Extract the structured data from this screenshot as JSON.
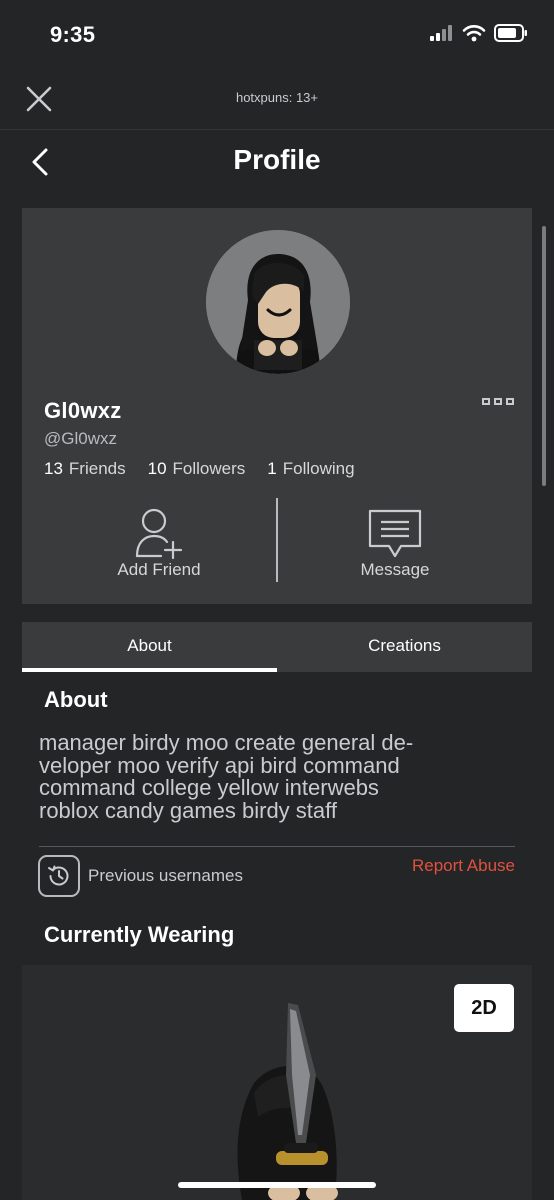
{
  "status_bar": {
    "time": "9:35"
  },
  "topbar": {
    "title": "hotxpuns: 13+",
    "close_icon": "close-icon"
  },
  "nav": {
    "page_title": "Profile",
    "back_icon": "chevron-left-icon"
  },
  "profile": {
    "display_name": "Gl0wxz",
    "username": "@Gl0wxz",
    "stats": [
      {
        "count": "13",
        "label": "Friends"
      },
      {
        "count": "10",
        "label": "Followers"
      },
      {
        "count": "1",
        "label": "Following"
      }
    ],
    "actions": {
      "add_friend": "Add Friend",
      "message": "Message"
    }
  },
  "tabs": [
    {
      "label": "About",
      "active": true
    },
    {
      "label": "Creations",
      "active": false
    }
  ],
  "about": {
    "heading": "About",
    "lines": [
      "manager birdy moo create general de-",
      "veloper moo verify api bird command",
      "command college yellow interwebs",
      "roblox candy games birdy staff"
    ],
    "previous_usernames": "Previous usernames",
    "report_abuse": "Report Abuse"
  },
  "wearing": {
    "heading": "Currently Wearing",
    "view_toggle": "2D"
  },
  "colors": {
    "background": "#232527",
    "card": "#393b3d",
    "report_red": "#e2513e"
  }
}
